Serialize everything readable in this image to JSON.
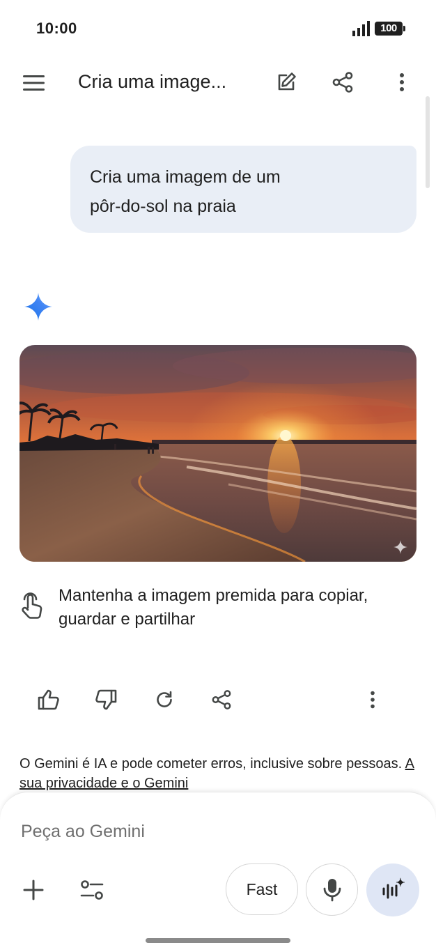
{
  "status_bar": {
    "time": "10:00",
    "battery": "100"
  },
  "app_bar": {
    "title": "Cria uma image...",
    "icons": [
      "menu-icon",
      "edit-icon",
      "share-icon",
      "more-vert-icon"
    ]
  },
  "conversation": {
    "user_message_lines": [
      "Cria uma imagem de um",
      "pôr-do-sol na praia"
    ],
    "response": {
      "image": "beach-sunset",
      "hint_lines": [
        "Mantenha a imagem premida para copiar,",
        "guardar e partilhar"
      ],
      "actions": [
        "thumb-up-icon",
        "thumb-down-icon",
        "refresh-icon",
        "share-icon",
        "more-vert-icon"
      ]
    }
  },
  "disclaimer": {
    "text": "O Gemini é IA e pode cometer erros, inclusive sobre pessoas. ",
    "link": "A sua privacidade e o Gemini"
  },
  "composer": {
    "placeholder": "Peça ao Gemini",
    "model_label": "Fast",
    "icons": [
      "plus-icon",
      "tools-icon",
      "mic-icon",
      "live-icon"
    ]
  },
  "colors": {
    "user_bubble": "#e9eef6",
    "live_button": "#dfe6f5",
    "gemini_blue": "#4285f4",
    "text": "#1f1f1f"
  }
}
